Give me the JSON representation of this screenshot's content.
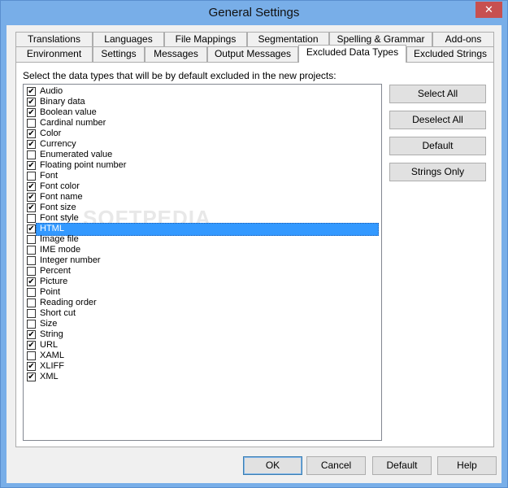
{
  "window": {
    "title": "General Settings"
  },
  "tabs_row1": [
    "Translations",
    "Languages",
    "File Mappings",
    "Segmentation",
    "Spelling & Grammar",
    "Add-ons"
  ],
  "tabs_row2": [
    "Environment",
    "Settings",
    "Messages",
    "Output Messages",
    "Excluded Data Types",
    "Excluded Strings"
  ],
  "active_tab": "Excluded Data Types",
  "panel": {
    "instruction": "Select the data types that will be by default excluded in the new projects:",
    "watermark": "SOFTPEDIA"
  },
  "data_types": [
    {
      "label": "Audio",
      "checked": true
    },
    {
      "label": "Binary data",
      "checked": true
    },
    {
      "label": "Boolean value",
      "checked": true
    },
    {
      "label": "Cardinal number",
      "checked": false
    },
    {
      "label": "Color",
      "checked": true
    },
    {
      "label": "Currency",
      "checked": true
    },
    {
      "label": "Enumerated value",
      "checked": false
    },
    {
      "label": "Floating point number",
      "checked": true
    },
    {
      "label": "Font",
      "checked": false
    },
    {
      "label": "Font color",
      "checked": true
    },
    {
      "label": "Font name",
      "checked": true
    },
    {
      "label": "Font size",
      "checked": true
    },
    {
      "label": "Font style",
      "checked": false
    },
    {
      "label": "HTML",
      "checked": true,
      "selected": true
    },
    {
      "label": "Image file",
      "checked": false
    },
    {
      "label": "IME mode",
      "checked": false
    },
    {
      "label": "Integer number",
      "checked": false
    },
    {
      "label": "Percent",
      "checked": false
    },
    {
      "label": "Picture",
      "checked": true
    },
    {
      "label": "Point",
      "checked": false
    },
    {
      "label": "Reading order",
      "checked": false
    },
    {
      "label": "Short cut",
      "checked": false
    },
    {
      "label": "Size",
      "checked": false
    },
    {
      "label": "String",
      "checked": true
    },
    {
      "label": "URL",
      "checked": true
    },
    {
      "label": "XAML",
      "checked": false
    },
    {
      "label": "XLIFF",
      "checked": true
    },
    {
      "label": "XML",
      "checked": true
    }
  ],
  "side_buttons": {
    "select_all": "Select All",
    "deselect_all": "Deselect All",
    "default": "Default",
    "strings_only": "Strings Only"
  },
  "bottom_buttons": {
    "ok": "OK",
    "cancel": "Cancel",
    "default": "Default",
    "help": "Help"
  },
  "icons": {
    "close": "close-icon",
    "check": "check-icon"
  },
  "colors": {
    "titlebar": "#78aee8",
    "close": "#c75050",
    "selection": "#3399ff"
  }
}
